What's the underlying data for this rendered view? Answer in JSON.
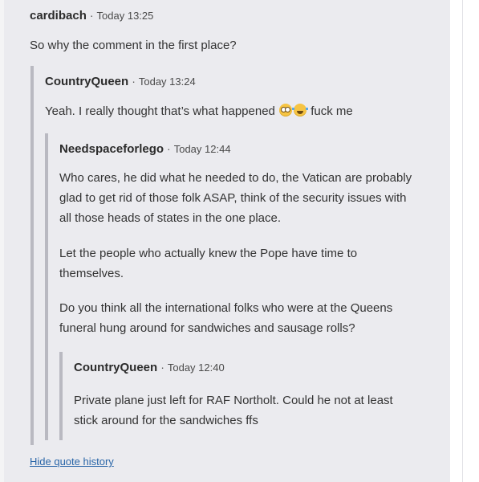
{
  "thread": {
    "outer": {
      "author": "cardibach",
      "separator": "·",
      "time": "Today 13:25",
      "text": "So why the comment in the first place?"
    },
    "level1": {
      "author": "CountryQueen",
      "separator": "·",
      "time": "Today 13:24",
      "text_before": "Yeah. I really thought that’s what happened",
      "emojis": [
        "flushed-face-emoji",
        "tears-of-joy-emoji"
      ],
      "text_after": "fuck me"
    },
    "level2": {
      "author": "Needspaceforlego",
      "separator": "·",
      "time": "Today 12:44",
      "paragraphs": [
        "Who cares, he did what he needed to do, the Vatican are probably glad to get rid of those folk ASAP, think of the security issues with all those heads of states in the one place.",
        "Let the people who actually knew the Pope have time to themselves.",
        "Do you think all the international folks who were at the Queens funeral hung around for sandwiches and sausage rolls?"
      ]
    },
    "level3": {
      "author": "CountryQueen",
      "separator": "·",
      "time": "Today 12:40",
      "text": "Private plane just left for RAF Northolt. Could he not at least stick around for the sandwiches ffs"
    }
  },
  "actions": {
    "hide_quote_history": "Hide quote history"
  },
  "colors": {
    "quote_background": "#ebebef",
    "quote_border": "#b9b9c1",
    "link": "#2a66a8"
  }
}
